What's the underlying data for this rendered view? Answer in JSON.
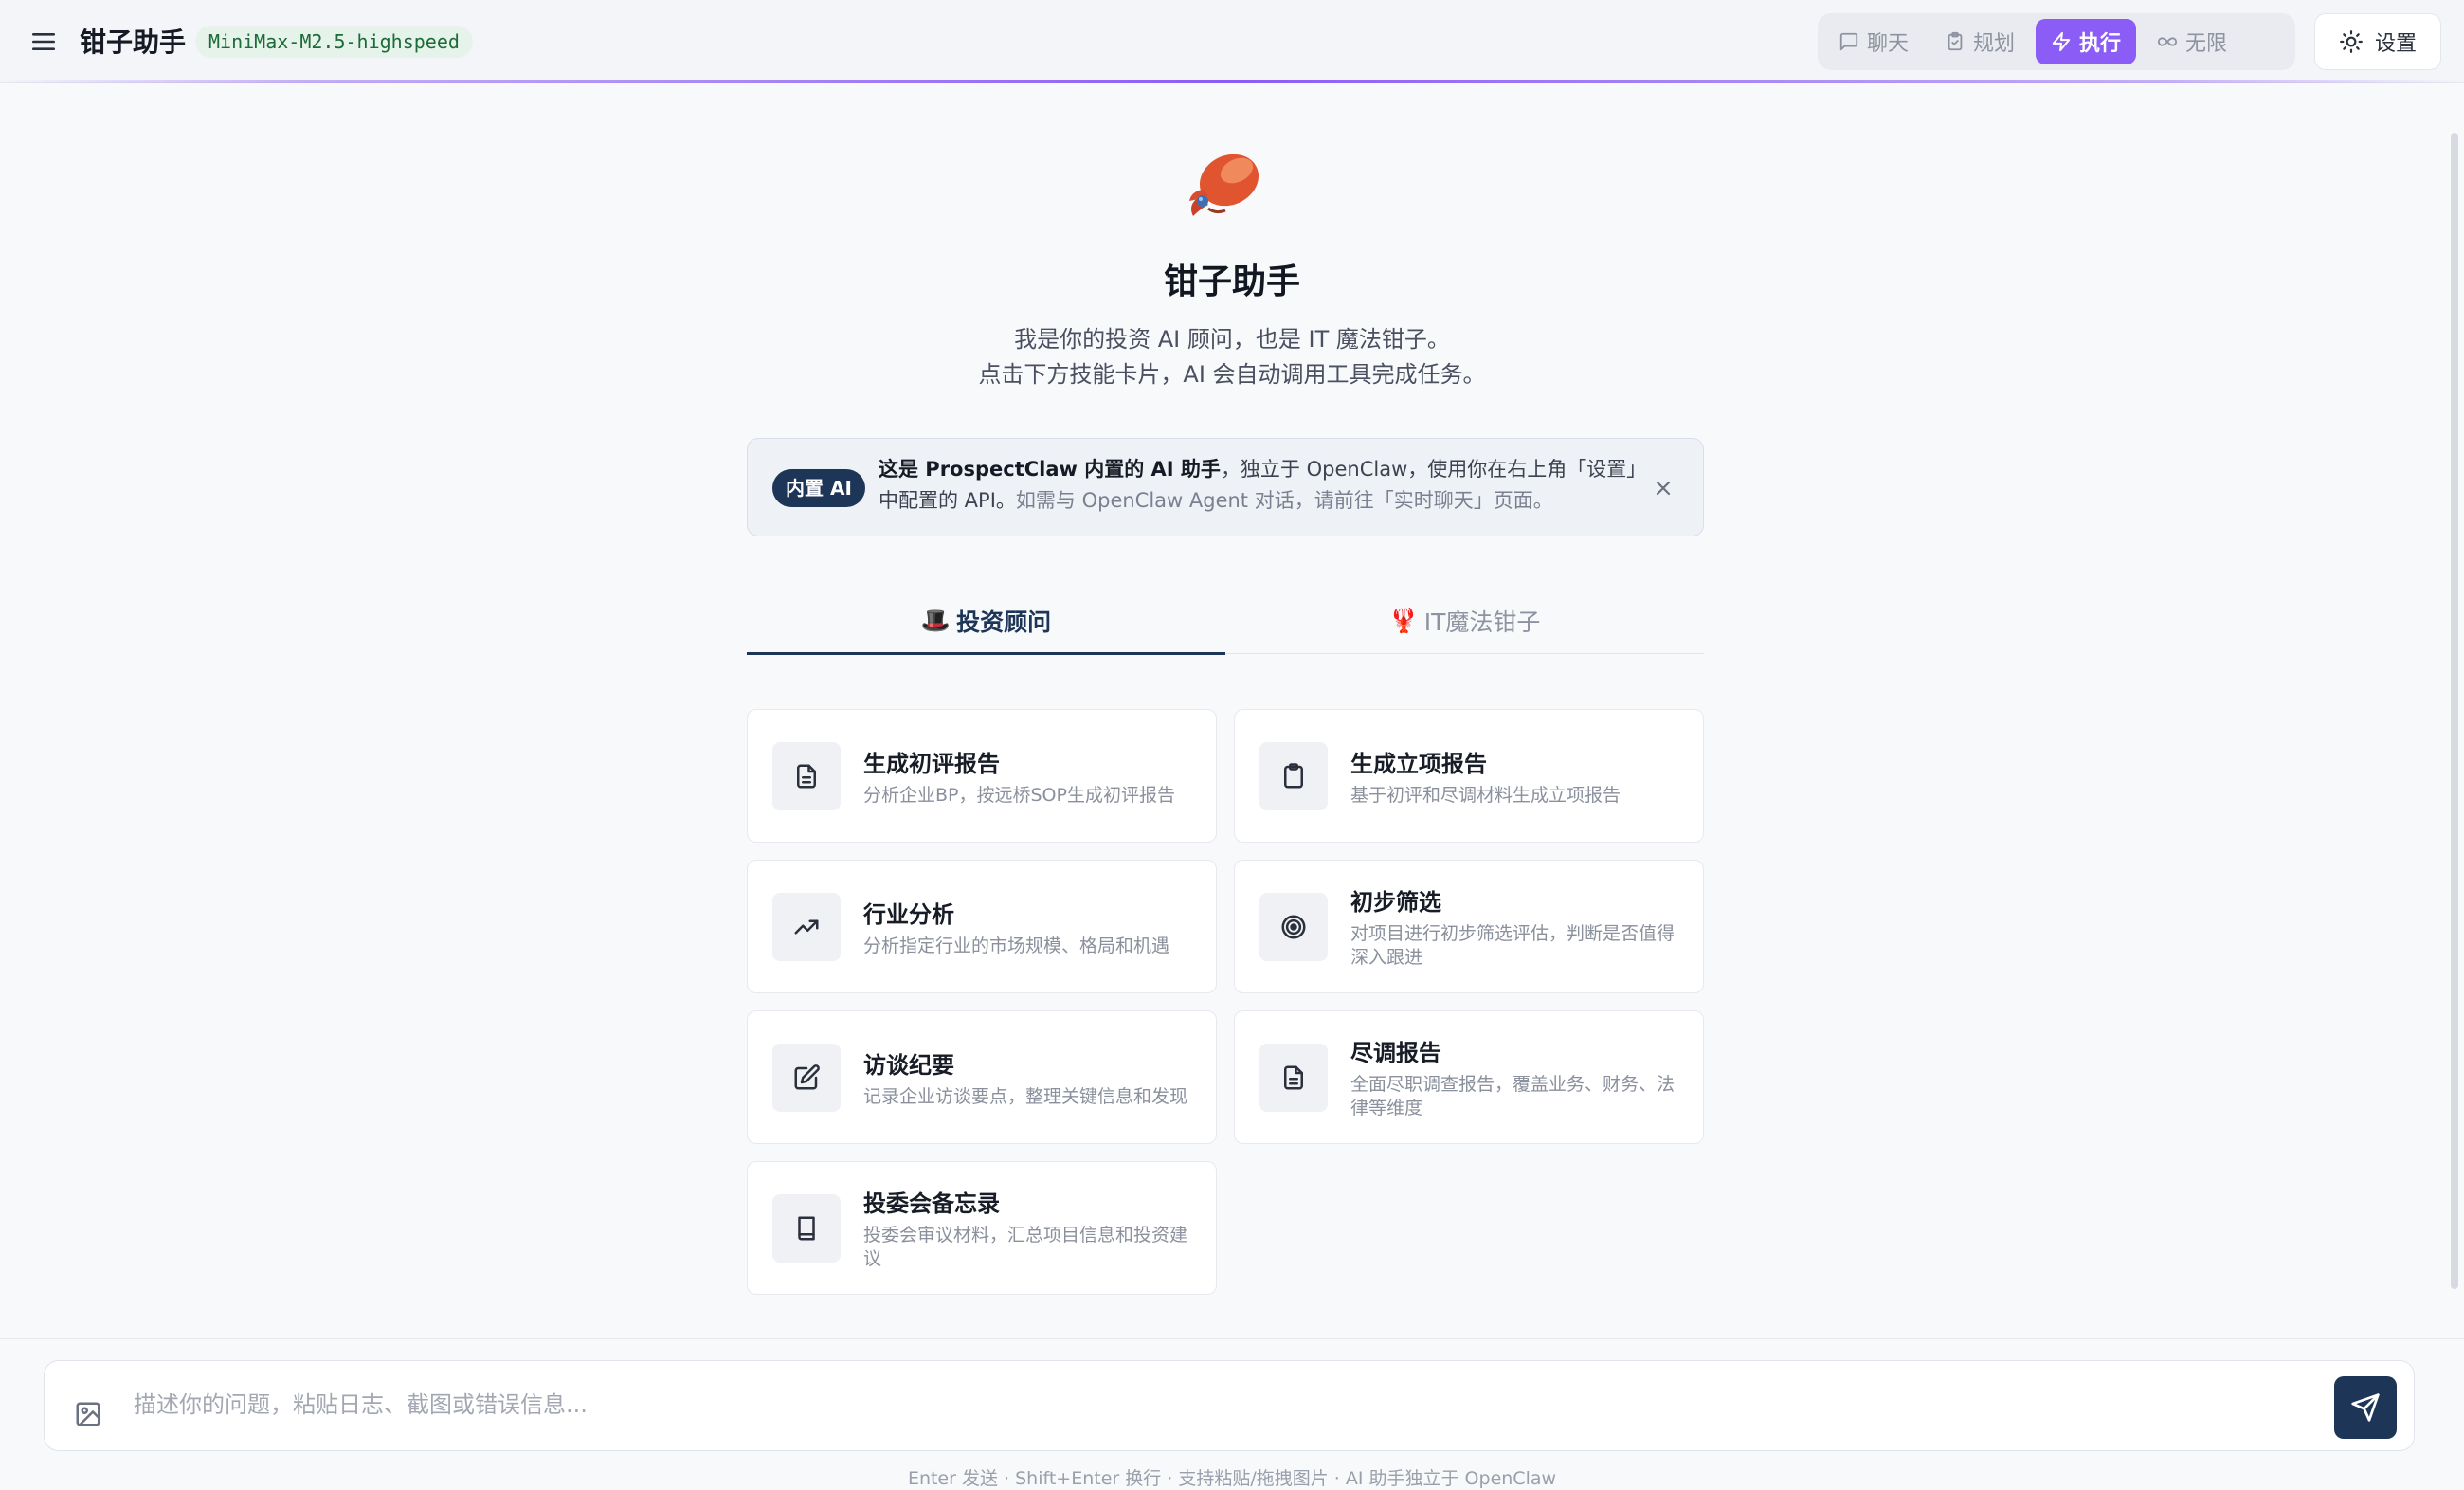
{
  "header": {
    "title": "钳子助手",
    "model": "MiniMax-M2.5-highspeed",
    "modes": [
      {
        "label": "聊天",
        "icon": "chat-bubble-icon",
        "active": false
      },
      {
        "label": "规划",
        "icon": "clipboard-check-icon",
        "active": false
      },
      {
        "label": "执行",
        "icon": "lightning-icon",
        "active": true
      },
      {
        "label": "无限",
        "icon": "infinity-icon",
        "active": false
      }
    ],
    "settings_label": "设置"
  },
  "hero": {
    "title": "钳子助手",
    "desc_line1": "我是你的投资 AI 顾问，也是 IT 魔法钳子。",
    "desc_line2": "点击下方技能卡片，AI 会自动调用工具完成任务。"
  },
  "notice": {
    "badge": "内置 AI",
    "bold": "这是 ProspectClaw 内置的 AI 助手",
    "text": "，独立于 OpenClaw，使用你在右上角「设置」中配置的 API。",
    "muted": "如需与 OpenClaw Agent 对话，请前往「实时聊天」页面。"
  },
  "tabs": [
    {
      "emoji": "🎩",
      "label": "投资顾问",
      "active": true
    },
    {
      "emoji": "🦞",
      "label": "IT魔法钳子",
      "active": false
    }
  ],
  "cards": [
    {
      "title": "生成初评报告",
      "desc": "分析企业BP，按远桥SOP生成初评报告",
      "icon": "document-icon"
    },
    {
      "title": "生成立项报告",
      "desc": "基于初评和尽调材料生成立项报告",
      "icon": "clipboard-icon"
    },
    {
      "title": "行业分析",
      "desc": "分析指定行业的市场规模、格局和机遇",
      "icon": "trending-up-icon"
    },
    {
      "title": "初步筛选",
      "desc": "对项目进行初步筛选评估，判断是否值得深入跟进",
      "icon": "target-icon"
    },
    {
      "title": "访谈纪要",
      "desc": "记录企业访谈要点，整理关键信息和发现",
      "icon": "edit-icon"
    },
    {
      "title": "尽调报告",
      "desc": "全面尽职调查报告，覆盖业务、财务、法律等维度",
      "icon": "document-icon"
    },
    {
      "title": "投委会备忘录",
      "desc": "投委会审议材料，汇总项目信息和投资建议",
      "icon": "book-icon"
    }
  ],
  "input": {
    "placeholder": "描述你的问题，粘贴日志、截图或错误信息...",
    "hint": "Enter 发送 · Shift+Enter 换行 · 支持粘贴/拖拽图片 · AI 助手独立于 OpenClaw"
  },
  "colors": {
    "accent": "#8b5cf6",
    "primary": "#1d3557",
    "model_badge_bg": "#e6f3ea",
    "model_badge_text": "#1d6b3a"
  }
}
